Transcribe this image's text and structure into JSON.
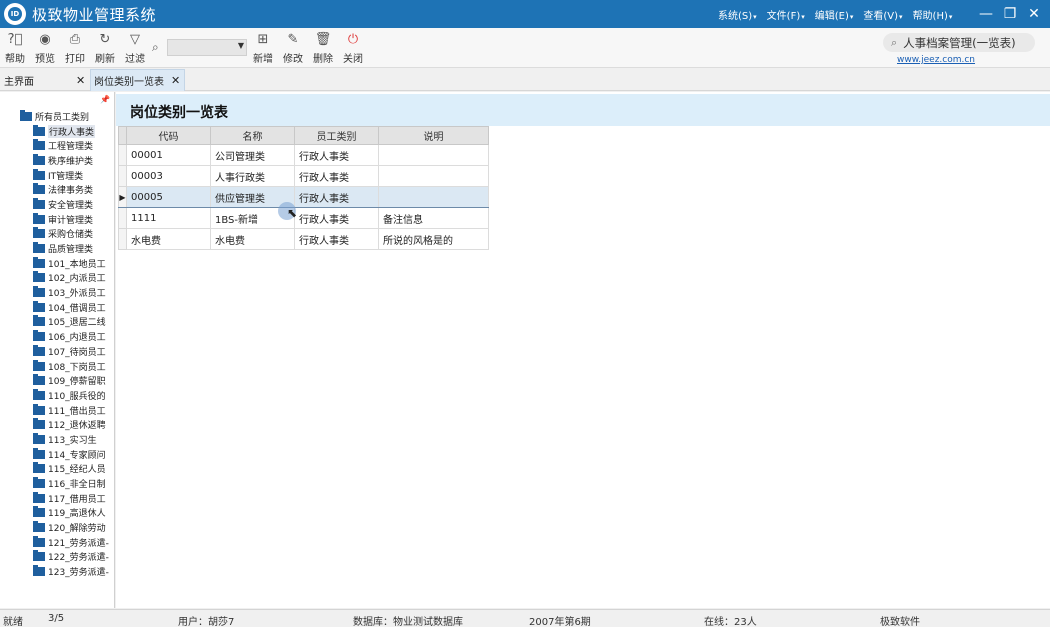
{
  "app": {
    "logo_text": "ID",
    "title": "极致物业管理系统",
    "menus": [
      "系统(S)",
      "文件(F)",
      "编辑(E)",
      "查看(V)",
      "帮助(H)"
    ],
    "window_buttons": [
      "—",
      "❐",
      "✕"
    ]
  },
  "toolbar": {
    "help": "帮助",
    "preview": "预览",
    "print": "打印",
    "refresh": "刷新",
    "filter": "过滤",
    "add": "新增",
    "edit": "修改",
    "delete": "删除",
    "close": "关闭",
    "module_search": "人事档案管理(一览表)",
    "site_link": "www.jeez.com.cn"
  },
  "tabs": [
    {
      "label": "主界面",
      "close": "✕"
    },
    {
      "label": "岗位类别一览表",
      "close": "✕"
    }
  ],
  "tree": {
    "pin": "📌",
    "root": "所有员工类别",
    "items": [
      "行政人事类",
      "工程管理类",
      "秩序维护类",
      "IT管理类",
      "法律事务类",
      "安全管理类",
      "审计管理类",
      "采购仓储类",
      "品质管理类",
      "101_本地员工",
      "102_内派员工",
      "103_外派员工",
      "104_借调员工",
      "105_退居二线",
      "106_内退员工",
      "107_待岗员工",
      "108_下岗员工",
      "109_停薪留职",
      "110_服兵役的",
      "111_借出员工",
      "112_退休返聘",
      "113_实习生",
      "114_专家顾问",
      "115_经纪人员",
      "116_非全日制",
      "117_借用员工",
      "119_高退休人",
      "120_解除劳动",
      "121_劳务派遣-",
      "122_劳务派遣-",
      "123_劳务派遣-"
    ],
    "selected_index": 0
  },
  "page": {
    "title": "岗位类别一览表"
  },
  "grid": {
    "columns": [
      "代码",
      "名称",
      "员工类别",
      "说明"
    ],
    "current_row_marker": "▶",
    "rows": [
      [
        "00001",
        "公司管理类",
        "行政人事类",
        ""
      ],
      [
        "00003",
        "人事行政类",
        "行政人事类",
        ""
      ],
      [
        "00005",
        "供应管理类",
        "行政人事类",
        ""
      ],
      [
        "1111",
        "1BS-新增",
        "行政人事类",
        "备注信息"
      ],
      [
        "水电费",
        "水电费",
        "行政人事类",
        "所说的风格是的"
      ]
    ],
    "selected_row": 2
  },
  "status": {
    "state": "就绪",
    "position": "3/5",
    "user": "用户：胡莎7",
    "database": "数据库：物业测试数据库",
    "period": "2007年第6期",
    "online": "在线：23人",
    "vendor": "极致软件"
  }
}
